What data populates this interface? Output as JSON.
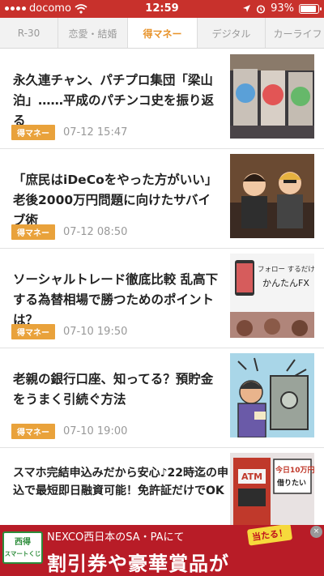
{
  "status_bar": {
    "carrier": "docomo",
    "time": "12:59",
    "battery": "93%",
    "battery_level": 0.93,
    "icons": [
      "signal-dots-icon",
      "wifi-icon",
      "location-arrow-icon",
      "alarm-icon",
      "battery-icon"
    ]
  },
  "tabs": [
    {
      "label": "R-30",
      "active": false
    },
    {
      "label": "恋愛・結婚",
      "active": false
    },
    {
      "label": "得マネー",
      "active": true
    },
    {
      "label": "デジタル",
      "active": false
    },
    {
      "label": "カーライフ",
      "active": false
    }
  ],
  "articles": [
    {
      "title": "永久連チャン、パチプロ集団「梁山泊」……平成のパチンコ史を振り返る",
      "category": "得マネー",
      "date": "07-12 15:47",
      "thumb": "pachinko-parlor"
    },
    {
      "title": "「庶民はiDeCoをやった方がいい」老後2000万円問題に向けたサバイブ術",
      "category": "得マネー",
      "date": "07-12 08:50",
      "thumb": "two-men-illustration"
    },
    {
      "title": "ソーシャルトレード徹底比較 乱高下する為替相場で勝つためのポイントは？",
      "category": "得マネー",
      "date": "07-10 19:50",
      "thumb": "forex-app"
    },
    {
      "title": "老親の銀行口座、知ってる？預貯金をうまく引続ぐ方法",
      "category": "得マネー",
      "date": "07-10 19:00",
      "thumb": "bank-safe-cartoon"
    },
    {
      "title": "スマホ完結申込みだから安心♪22時迄の申込で最短即日融資可能！免許証だけでOK",
      "thumb": "atm-loan"
    }
  ],
  "ad": {
    "logo_top": "西得",
    "logo_bottom": "スマートくじ",
    "line1": "NEXCO西日本のSA・PAにて",
    "line2": "割引券や豪華賞品が",
    "burst": "当たる！",
    "close": "×"
  },
  "thumb_text": {
    "forex_headline": "フォロー するだけの",
    "forex_sub": "かんたんFX",
    "atm_label": "ATM",
    "atm_amount": "今日10万円",
    "atm_want": "借りたい"
  },
  "colors": {
    "status_bar": "#c8312c",
    "accent": "#e8932a",
    "badge": "#e9a23b",
    "ad_bg": "#b81c27"
  }
}
